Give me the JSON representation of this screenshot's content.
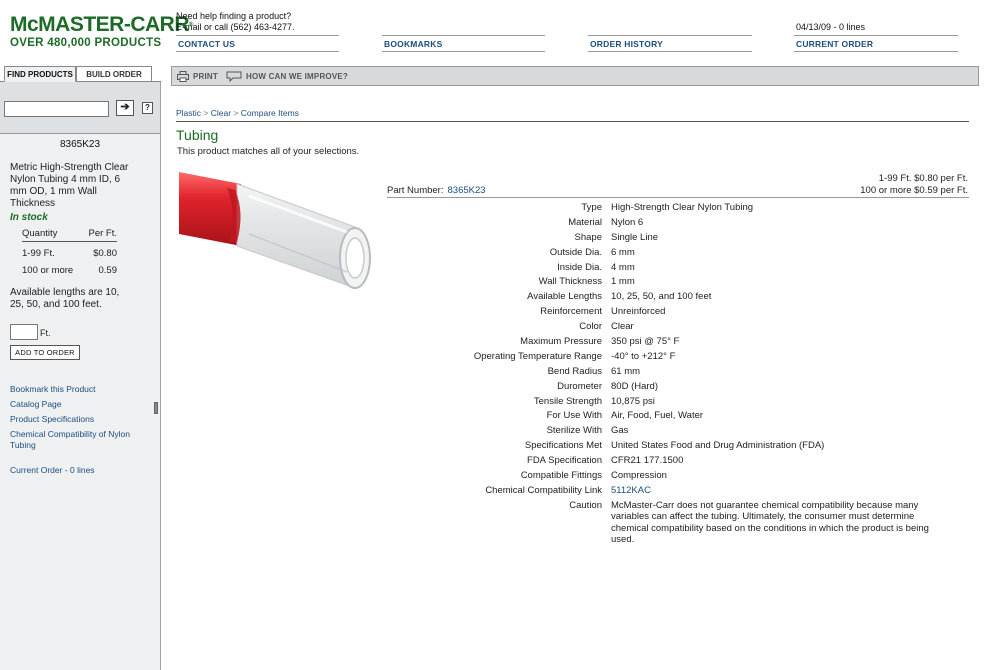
{
  "header": {
    "logo_main": "McMASTER-CARR",
    "logo_sub": "OVER 480,000 PRODUCTS",
    "help_line1": "Need help finding a product?",
    "help_line2": "E-mail or call (562) 463-4277.",
    "date_lines": "04/13/09 - 0 lines",
    "nav": [
      "CONTACT US",
      "BOOKMARKS",
      "ORDER HISTORY",
      "CURRENT ORDER"
    ]
  },
  "sidebar": {
    "tabs": [
      "FIND PRODUCTS",
      "BUILD ORDER"
    ],
    "search_value": "",
    "go_glyph": "➔",
    "help_glyph": "?",
    "part_number": "8365K23",
    "description": "Metric High-Strength Clear Nylon Tubing 4 mm ID, 6 mm OD, 1 mm Wall Thickness",
    "stock": "In stock",
    "qty_header": "Quantity",
    "price_header": "Per Ft.",
    "price_rows": [
      {
        "qty": "1-99 Ft.",
        "price": "$0.80"
      },
      {
        "qty": "100 or more",
        "price": "0.59"
      }
    ],
    "available": "Available lengths are 10, 25, 50, and 100 feet.",
    "qty_value": "",
    "unit": "Ft.",
    "add_button": "ADD TO ORDER",
    "links": [
      "Bookmark this Product",
      "Catalog Page",
      "Product Specifications",
      "Chemical Compatibility of Nylon Tubing"
    ],
    "current_order": "Current Order - 0 lines"
  },
  "toolbar": {
    "print": "PRINT",
    "improve": "HOW CAN WE IMPROVE?"
  },
  "main": {
    "breadcrumbs": [
      "Plastic",
      "Clear",
      "Compare Items"
    ],
    "breadcrumb_sep": ">",
    "title": "Tubing",
    "match_text": "This product matches all of your selections.",
    "price_line1": "1-99 Ft. $0.80 per Ft.",
    "price_line2": "100 or more $0.59 per Ft.",
    "part_label": "Part Number:",
    "part_value": "8365K23",
    "specs": [
      {
        "label": "Type",
        "value": "High-Strength Clear Nylon Tubing"
      },
      {
        "label": "Material",
        "value": "Nylon 6"
      },
      {
        "label": "Shape",
        "value": "Single Line"
      },
      {
        "label": "Outside Dia.",
        "value": "6 mm"
      },
      {
        "label": "Inside Dia.",
        "value": "4 mm"
      },
      {
        "label": "Wall Thickness",
        "value": "1 mm"
      },
      {
        "label": "Available Lengths",
        "value": "10, 25, 50, and 100 feet"
      },
      {
        "label": "Reinforcement",
        "value": "Unreinforced"
      },
      {
        "label": "Color",
        "value": "Clear"
      },
      {
        "label": "Maximum Pressure",
        "value": "350 psi @ 75° F"
      },
      {
        "label": "Operating Temperature Range",
        "value": "-40° to +212° F"
      },
      {
        "label": "Bend Radius",
        "value": "61 mm"
      },
      {
        "label": "Durometer",
        "value": "80D (Hard)"
      },
      {
        "label": "Tensile Strength",
        "value": "10,875 psi"
      },
      {
        "label": "For Use With",
        "value": "Air, Food, Fuel, Water"
      },
      {
        "label": "Sterilize With",
        "value": "Gas"
      },
      {
        "label": "Specifications Met",
        "value": "United States Food and Drug Administration (FDA)"
      },
      {
        "label": "FDA Specification",
        "value": "CFR21 177.1500"
      },
      {
        "label": "Compatible Fittings",
        "value": "Compression"
      },
      {
        "label": "Chemical Compatibility Link",
        "value": "5112KAC"
      },
      {
        "label": "Caution",
        "value": "McMaster-Carr does not guarantee chemical compatibility because many variables can affect the tubing. Ultimately, the consumer must determine chemical compatibility based on the conditions in which the product is being used."
      }
    ]
  },
  "colors": {
    "brand_green": "#1c6b26",
    "link_blue": "#1c4e80",
    "tube_red": "#d9202a"
  }
}
